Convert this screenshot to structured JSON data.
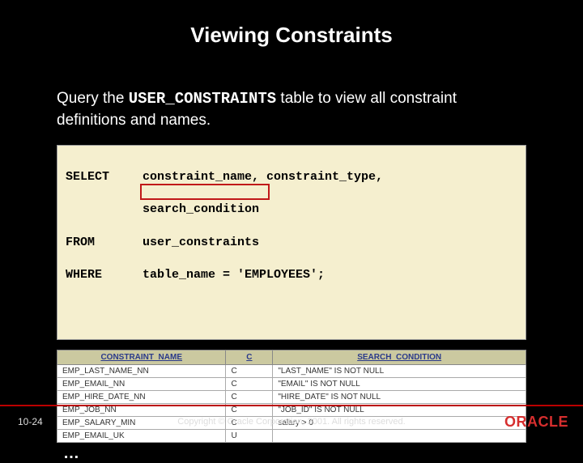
{
  "title": "Viewing Constraints",
  "intro": {
    "prefix": "Query the ",
    "code": "USER_CONSTRAINTS",
    "suffix": " table to view all constraint definitions and names."
  },
  "sql": {
    "select_kw": "SELECT",
    "select_cols1": "constraint_name, constraint_type,",
    "select_cols2": "search_condition",
    "from_kw": "FROM",
    "from_val": "user_constraints",
    "where_kw": "WHERE",
    "where_val": "table_name = 'EMPLOYEES';"
  },
  "table": {
    "headers": {
      "name": "CONSTRAINT_NAME",
      "c": "C",
      "cond": "SEARCH_CONDITION"
    },
    "rows": [
      {
        "name": "EMP_LAST_NAME_NN",
        "c": "C",
        "cond": "\"LAST_NAME\" IS NOT NULL"
      },
      {
        "name": "EMP_EMAIL_NN",
        "c": "C",
        "cond": "\"EMAIL\" IS NOT NULL"
      },
      {
        "name": "EMP_HIRE_DATE_NN",
        "c": "C",
        "cond": "\"HIRE_DATE\" IS NOT NULL"
      },
      {
        "name": "EMP_JOB_NN",
        "c": "C",
        "cond": "\"JOB_ID\" IS NOT NULL"
      },
      {
        "name": "EMP_SALARY_MIN",
        "c": "C",
        "cond": "salary > 0"
      },
      {
        "name": "EMP_EMAIL_UK",
        "c": "U",
        "cond": ""
      }
    ]
  },
  "ellipsis": "…",
  "footer": {
    "page": "10-24",
    "copyright": "Copyright © Oracle Corporation, 2001. All rights reserved.",
    "logo": "ORACLE"
  }
}
